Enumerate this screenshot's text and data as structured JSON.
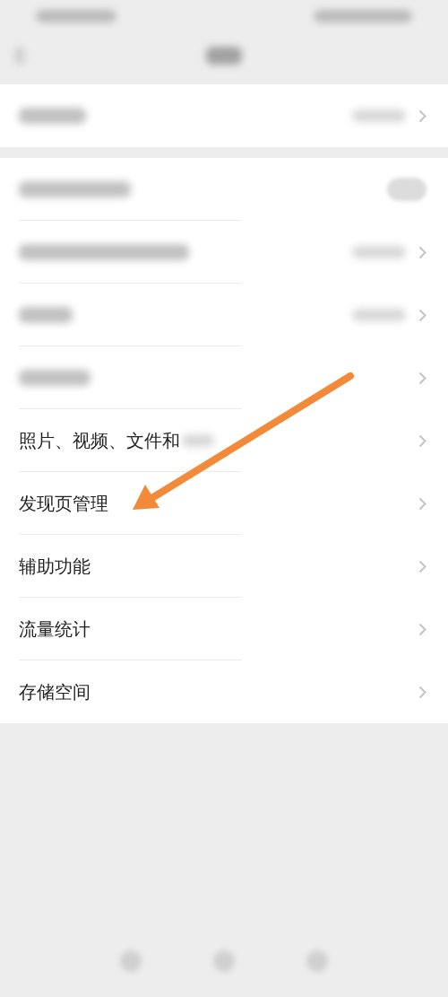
{
  "status_bar": {
    "kind": "blurred"
  },
  "nav_bar": {
    "kind": "blurred"
  },
  "sections": [
    {
      "rows": [
        {
          "kind": "blurred_value"
        }
      ]
    },
    {
      "rows": [
        {
          "kind": "blurred_toggle",
          "on": false
        },
        {
          "kind": "blurred_value"
        },
        {
          "kind": "blurred_value"
        },
        {
          "kind": "blurred_plain"
        },
        {
          "kind": "partial",
          "label": "照片、视频、文件和"
        },
        {
          "kind": "text",
          "label": "发现页管理"
        },
        {
          "kind": "text",
          "label": "辅助功能"
        },
        {
          "kind": "text",
          "label": "流量统计"
        },
        {
          "kind": "text",
          "label": "存储空间"
        }
      ]
    }
  ],
  "annotation": {
    "kind": "arrow"
  },
  "bottom_bar": {
    "kind": "blurred"
  }
}
